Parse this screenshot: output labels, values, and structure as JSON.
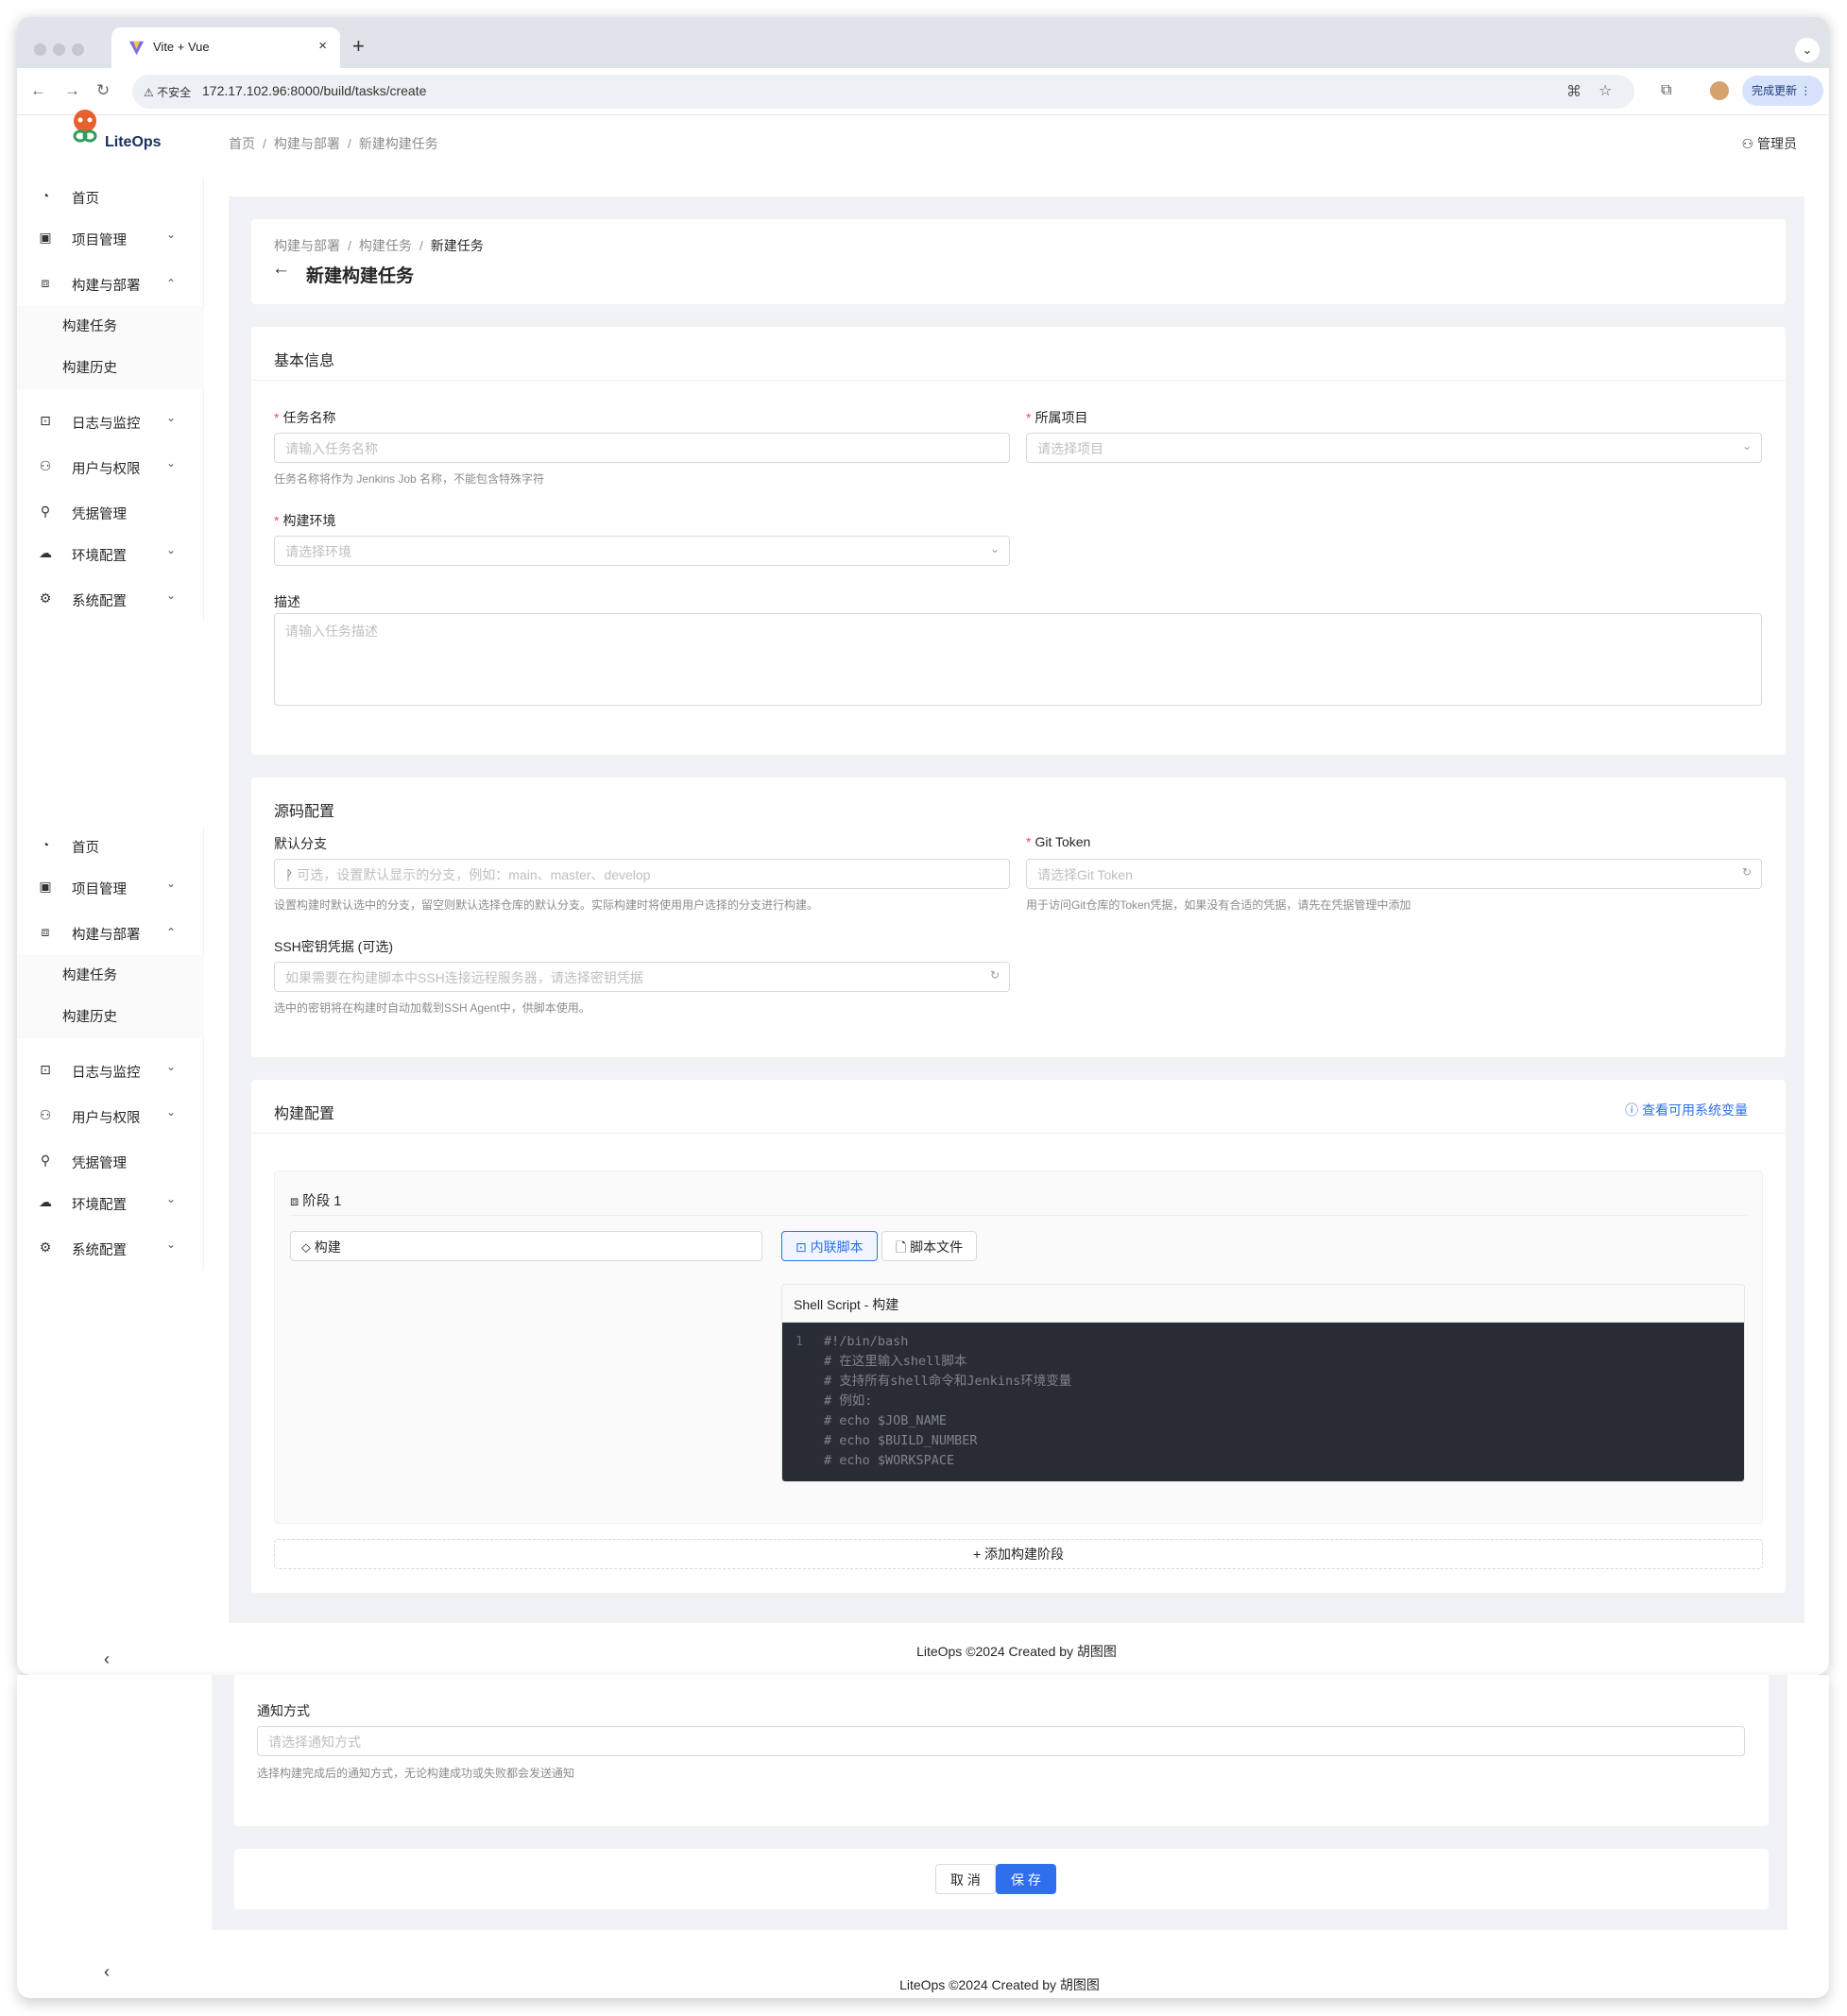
{
  "browser": {
    "tab_title": "Vite + Vue",
    "tab_close": "×",
    "new_tab": "+",
    "insecure_label": "不安全",
    "url": "172.17.102.96:8000/build/tasks/create",
    "update_button": "完成更新"
  },
  "header": {
    "logo_text": "LiteOps",
    "breadcrumb": [
      "首页",
      "构建与部署",
      "新建构建任务"
    ],
    "separator": "/",
    "user": "管理员"
  },
  "sidebar": {
    "items": [
      {
        "label": "首页",
        "icon": "dashboard-icon"
      },
      {
        "label": "项目管理",
        "icon": "project-icon"
      },
      {
        "label": "构建与部署",
        "icon": "build-icon"
      },
      {
        "label": "日志与监控",
        "icon": "log-icon"
      },
      {
        "label": "用户与权限",
        "icon": "user-icon"
      },
      {
        "label": "凭据管理",
        "icon": "key-icon"
      },
      {
        "label": "环境配置",
        "icon": "cloud-icon"
      },
      {
        "label": "系统配置",
        "icon": "gear-icon"
      }
    ],
    "sub_items": [
      "构建任务",
      "构建历史"
    ]
  },
  "page": {
    "breadcrumb": [
      "构建与部署",
      "构建任务",
      "新建任务"
    ],
    "title": "新建构建任务"
  },
  "basic": {
    "title": "基本信息",
    "task_name_label": "任务名称",
    "task_name_placeholder": "请输入任务名称",
    "task_name_help": "任务名称将作为 Jenkins Job 名称，不能包含特殊字符",
    "project_label": "所属项目",
    "project_placeholder": "请选择项目",
    "env_label": "构建环境",
    "env_placeholder": "请选择环境",
    "desc_label": "描述",
    "desc_placeholder": "请输入任务描述"
  },
  "source": {
    "title": "源码配置",
    "branch_label": "默认分支",
    "branch_placeholder": "可选，设置默认显示的分支，例如：main、master、develop",
    "branch_help": "设置构建时默认选中的分支，留空则默认选择仓库的默认分支。实际构建时将使用用户选择的分支进行构建。",
    "token_label": "Git Token",
    "token_placeholder": "请选择Git Token",
    "token_help": "用于访问Git仓库的Token凭据，如果没有合适的凭据，请先在凭据管理中添加",
    "ssh_label": "SSH密钥凭据 (可选)",
    "ssh_placeholder": "如果需要在构建脚本中SSH连接远程服务器，请选择密钥凭据",
    "ssh_help": "选中的密钥将在构建时自动加载到SSH Agent中，供脚本使用。"
  },
  "build": {
    "title": "构建配置",
    "view_vars": "查看可用系统变量",
    "stage_label": "阶段 1",
    "stage_name": "构建",
    "inline_script": "内联脚本",
    "script_file": "脚本文件",
    "editor_title": "Shell Script - 构建",
    "code_lines": [
      "#!/bin/bash",
      "# 在这里输入shell脚本",
      "# 支持所有shell命令和Jenkins环境变量",
      "# 例如:",
      "# echo $JOB_NAME",
      "# echo $BUILD_NUMBER",
      "# echo $WORKSPACE"
    ],
    "add_stage": "添加构建阶段"
  },
  "notify": {
    "label": "通知方式",
    "placeholder": "请选择通知方式",
    "help": "选择构建完成后的通知方式，无论构建成功或失败都会发送通知"
  },
  "actions": {
    "cancel": "取 消",
    "save": "保 存"
  },
  "footer": "LiteOps ©2024 Created by 胡图图",
  "colors": {
    "primary": "#2f6fed",
    "required": "#ff4d4f",
    "content_bg": "#f0f2f5",
    "editor_bg": "#282c34"
  }
}
